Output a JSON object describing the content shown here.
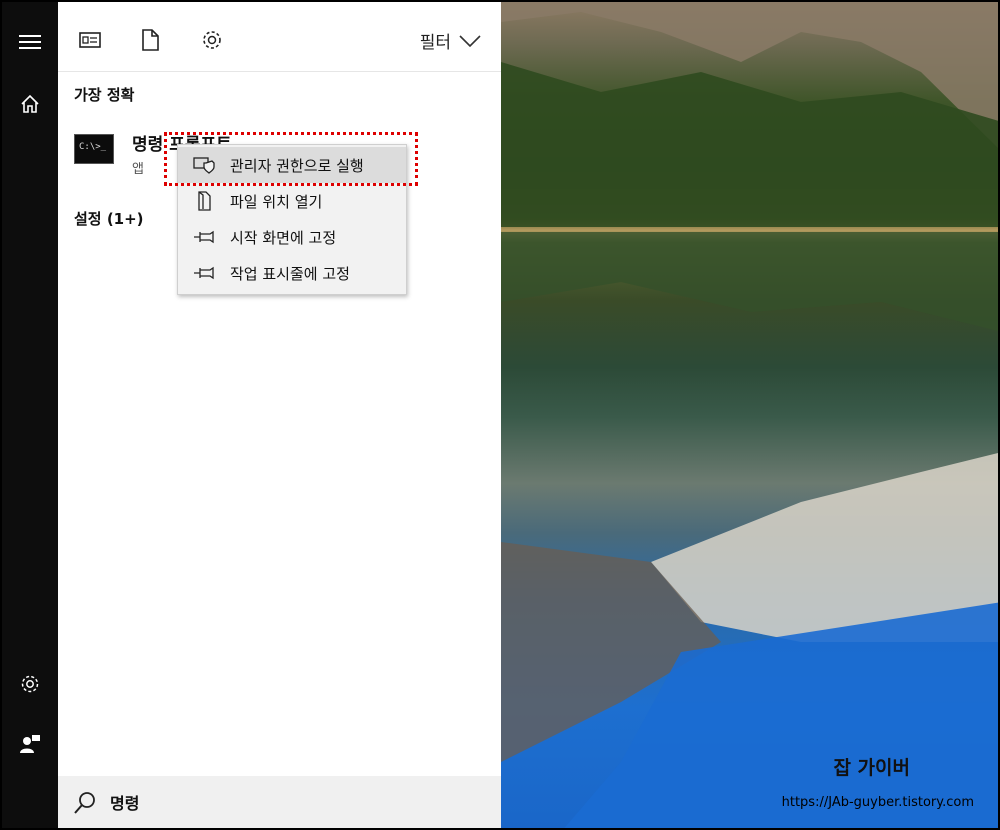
{
  "toolbar": {
    "filter_label": "필터"
  },
  "results": {
    "best_match_title": "가장 정확",
    "top_result_name": "명령 프롬프트",
    "top_result_type": "앱",
    "settings_title": "설정 (1+)"
  },
  "context_menu": {
    "items": [
      {
        "label": "관리자 권한으로 실행",
        "icon": "shield-icon",
        "active": true
      },
      {
        "label": "파일 위치 열기",
        "icon": "folder-icon",
        "active": false
      },
      {
        "label": "시작 화면에 고정",
        "icon": "pin-icon",
        "active": false
      },
      {
        "label": "작업 표시줄에 고정",
        "icon": "pin-icon",
        "active": false
      }
    ]
  },
  "search": {
    "value": "명령"
  },
  "watermark": {
    "title": "잡 가이버",
    "url": "https://JAb-guyber.tistory.com"
  },
  "colors": {
    "highlight": "#dd0000",
    "rail": "#0d0d0d",
    "menu_bg": "#f2f2f2"
  }
}
